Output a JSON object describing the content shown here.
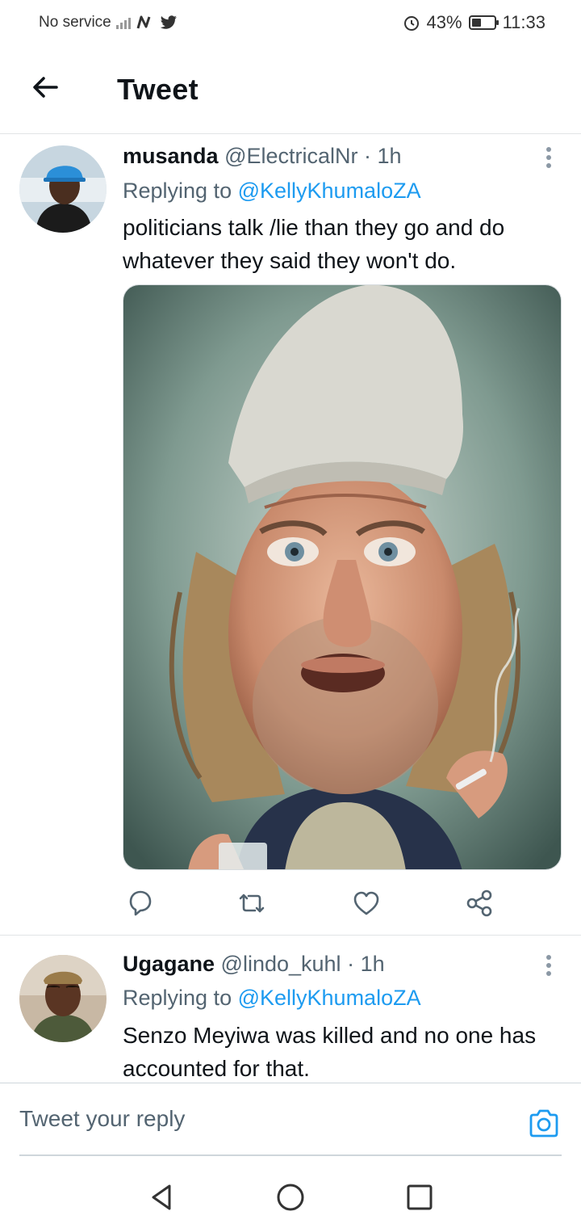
{
  "status_bar": {
    "carrier": "No service",
    "battery_percent": "43%",
    "battery_level": 0.43,
    "time": "11:33",
    "icons": [
      "signal-icon",
      "nfc-icon",
      "twitter-icon",
      "alarm-icon",
      "battery-icon"
    ]
  },
  "header": {
    "title": "Tweet",
    "back_icon": "arrow-left-icon"
  },
  "tweets": [
    {
      "name": "musanda",
      "handle": "@ElectricalNr",
      "time": "· 1h",
      "replying_prefix": "Replying to ",
      "replying_to": "@KellyKhumaloZA",
      "text": "politicians talk /lie than they go and do whatever they said they won't do.",
      "has_media": true,
      "media_description_icon": "caricature-image"
    },
    {
      "name": "Ugagane",
      "handle": "@lindo_kuhl",
      "time": "· 1h",
      "replying_prefix": "Replying to ",
      "replying_to": "@KellyKhumaloZA",
      "text": "Senzo Meyiwa was killed and no one has accounted for that.",
      "has_media": false
    }
  ],
  "actions": [
    "reply-icon",
    "retweet-icon",
    "like-icon",
    "share-icon"
  ],
  "reply_bar": {
    "placeholder": "Tweet your reply",
    "camera_icon": "camera-icon"
  },
  "nav": [
    "back-triangle-icon",
    "home-circle-icon",
    "recents-square-icon"
  ],
  "colors": {
    "accent": "#1d9bf0",
    "text": "#0f1419",
    "secondary": "#536471",
    "divider": "#e1e4e6"
  }
}
